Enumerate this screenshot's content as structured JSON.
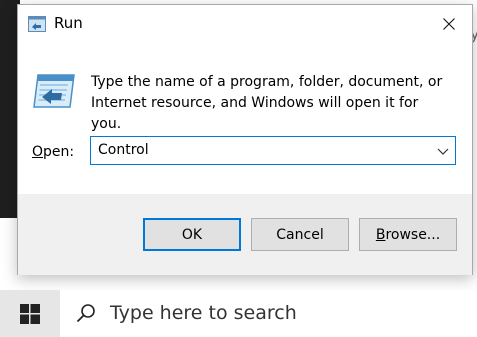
{
  "background": {
    "peek_text_1": "y",
    "peek_text_2": "it",
    "peek_text_3": "f"
  },
  "dialog": {
    "title": "Run",
    "description": "Type the name of a program, folder, document, or Internet resource, and Windows will open it for you.",
    "open_label_access": "O",
    "open_label_rest": "pen:",
    "input_value": "Control",
    "ok_label": "OK",
    "cancel_label": "Cancel",
    "browse_label_access": "B",
    "browse_label_rest": "rowse..."
  },
  "taskbar": {
    "search_placeholder": "Type here to search"
  },
  "colors": {
    "accent": "#0078d7",
    "footer": "#f0f0f0",
    "button": "#e1e1e1"
  },
  "icons": [
    "run-icon",
    "close-icon",
    "chevron-down-icon",
    "windows-logo-icon",
    "search-icon"
  ]
}
